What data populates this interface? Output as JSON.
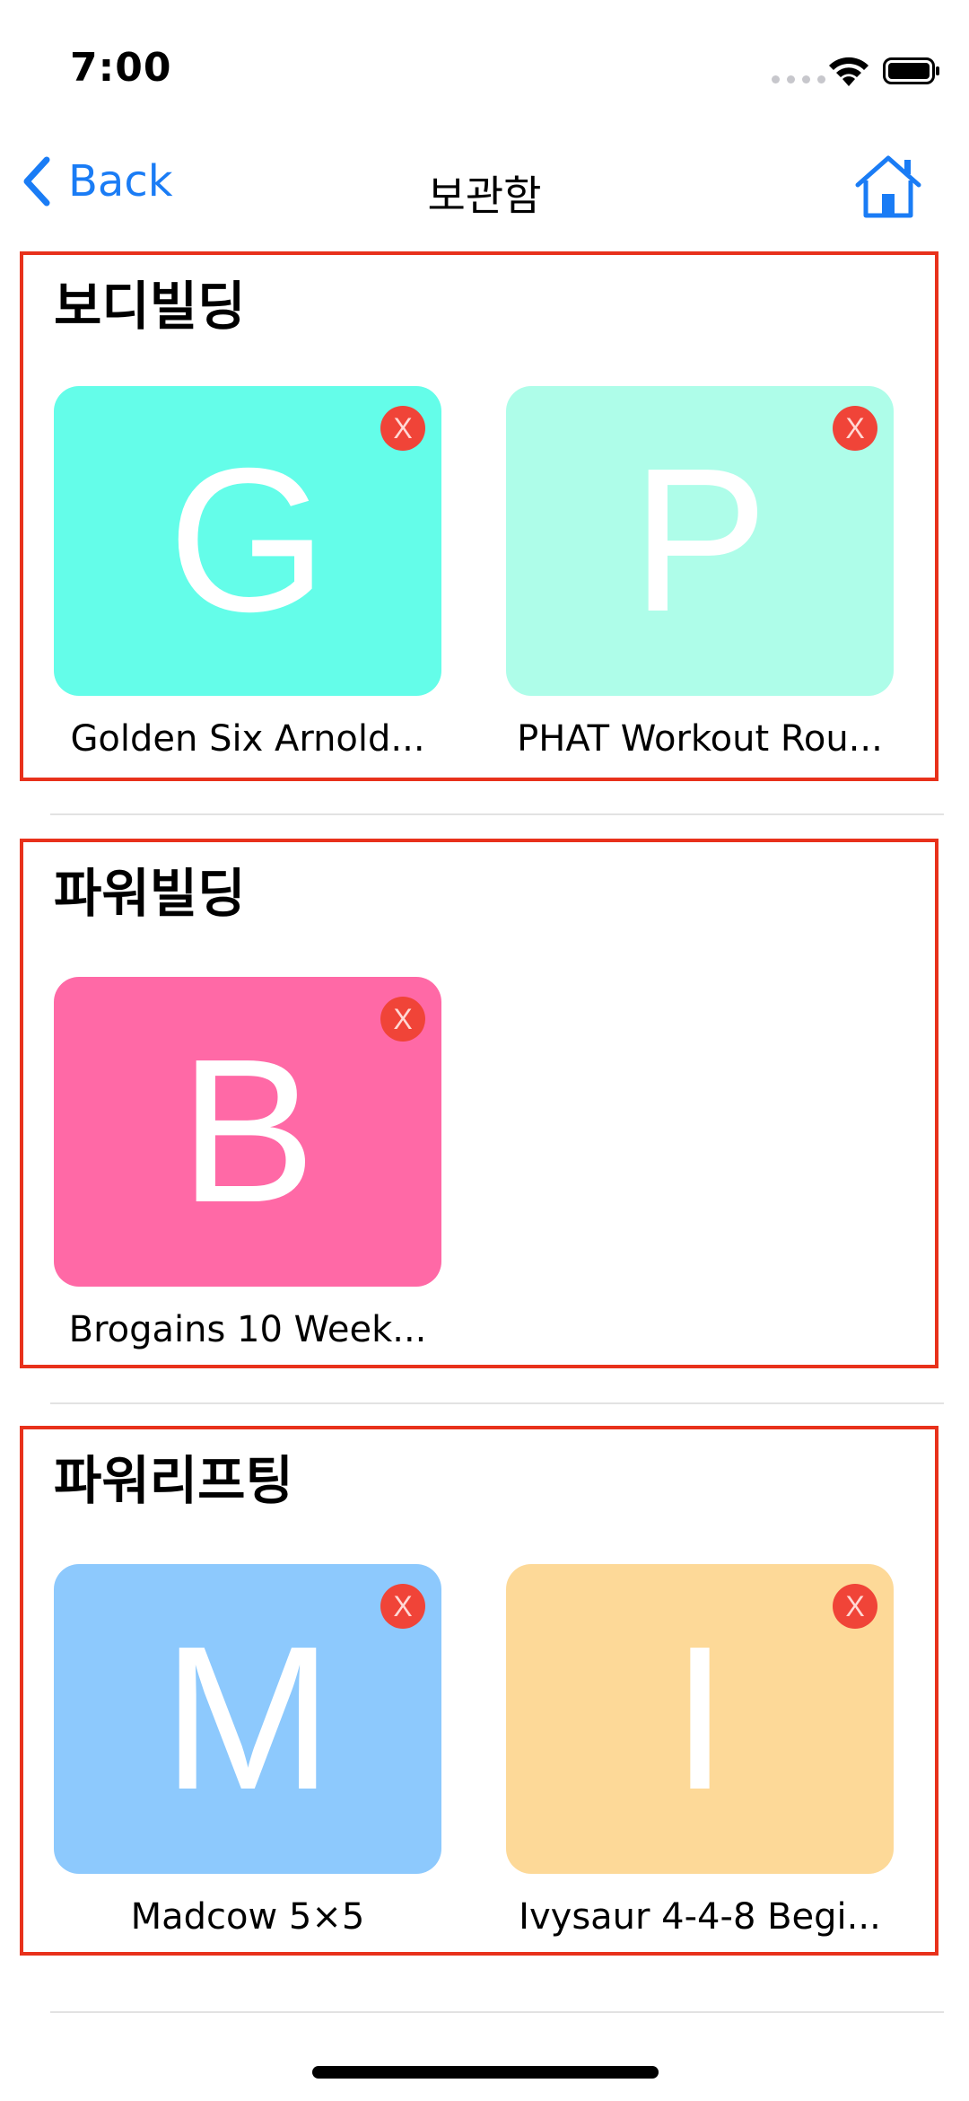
{
  "status": {
    "time": "7:00"
  },
  "nav": {
    "back_label": "Back",
    "title": "보관함"
  },
  "sections": [
    {
      "title": "보디빌딩",
      "items": [
        {
          "letter": "G",
          "label": "Golden Six Arnold...",
          "color": "#64fde9",
          "delete": "X"
        },
        {
          "letter": "P",
          "label": "PHAT Workout Rou...",
          "color": "#aefde9",
          "delete": "X"
        }
      ]
    },
    {
      "title": "파워빌딩",
      "items": [
        {
          "letter": "B",
          "label": "Brogains 10 Week...",
          "color": "#ff69a6",
          "delete": "X"
        }
      ]
    },
    {
      "title": "파워리프팅",
      "items": [
        {
          "letter": "M",
          "label": "Madcow 5×5",
          "color": "#8dc9fd",
          "delete": "X"
        },
        {
          "letter": "I",
          "label": "Ivysaur 4-4-8 Begi...",
          "color": "#fdd998",
          "delete": "X"
        }
      ]
    }
  ],
  "colors": {
    "accent": "#1a7cf5",
    "section_border": "#e8311b",
    "delete_badge": "#f04438"
  }
}
